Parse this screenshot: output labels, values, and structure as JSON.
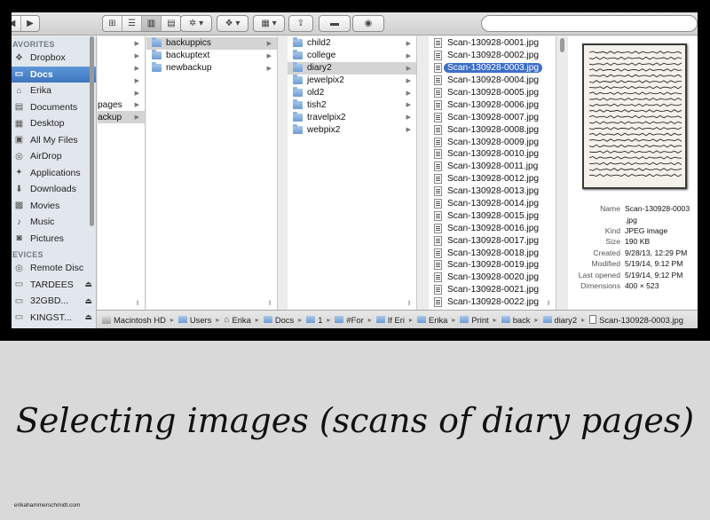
{
  "sidebar": {
    "sections": [
      {
        "title": "AVORITES",
        "items": [
          {
            "label": "Dropbox",
            "icon": "dropbox-icon"
          },
          {
            "label": "Docs",
            "icon": "folder-icon",
            "selected": true
          },
          {
            "label": "Erika",
            "icon": "home-icon"
          },
          {
            "label": "Documents",
            "icon": "documents-icon"
          },
          {
            "label": "Desktop",
            "icon": "desktop-icon"
          },
          {
            "label": "All My Files",
            "icon": "all-files-icon"
          },
          {
            "label": "AirDrop",
            "icon": "airdrop-icon"
          },
          {
            "label": "Applications",
            "icon": "applications-icon"
          },
          {
            "label": "Downloads",
            "icon": "downloads-icon"
          },
          {
            "label": "Movies",
            "icon": "movies-icon"
          },
          {
            "label": "Music",
            "icon": "music-icon"
          },
          {
            "label": "Pictures",
            "icon": "pictures-icon"
          }
        ]
      },
      {
        "title": "EVICES",
        "items": [
          {
            "label": "Remote Disc",
            "icon": "disc-icon"
          },
          {
            "label": "TARDEES",
            "icon": "drive-icon",
            "eject": true
          },
          {
            "label": "32GBD...",
            "icon": "drive-icon",
            "eject": true
          },
          {
            "label": "KINGST...",
            "icon": "drive-icon",
            "eject": true
          }
        ]
      }
    ]
  },
  "columns": {
    "col1": [
      "",
      "",
      "",
      "",
      "",
      "pages",
      "ackup"
    ],
    "col2": [
      "backuppics",
      "backuptext",
      "newbackup"
    ],
    "col3": [
      "child2",
      "college",
      "diary2",
      "jewelpix2",
      "old2",
      "tish2",
      "travelpix2",
      "webpix2"
    ],
    "col4": [
      "Scan-130928-0001.jpg",
      "Scan-130928-0002.jpg",
      "Scan-130928-0003.jpg",
      "Scan-130928-0004.jpg",
      "Scan-130928-0005.jpg",
      "Scan-130928-0006.jpg",
      "Scan-130928-0007.jpg",
      "Scan-130928-0008.jpg",
      "Scan-130928-0009.jpg",
      "Scan-130928-0010.jpg",
      "Scan-130928-0011.jpg",
      "Scan-130928-0012.jpg",
      "Scan-130928-0013.jpg",
      "Scan-130928-0014.jpg",
      "Scan-130928-0015.jpg",
      "Scan-130928-0016.jpg",
      "Scan-130928-0017.jpg",
      "Scan-130928-0018.jpg",
      "Scan-130928-0019.jpg",
      "Scan-130928-0020.jpg",
      "Scan-130928-0021.jpg",
      "Scan-130928-0022.jpg"
    ]
  },
  "preview": {
    "info": [
      {
        "k": "Name",
        "v": "Scan-130928-0003"
      },
      {
        "k": "",
        "v": ".jpg"
      },
      {
        "k": "Kind",
        "v": "JPEG image"
      },
      {
        "k": "Size",
        "v": "190 KB"
      },
      {
        "k": "Created",
        "v": "9/28/13, 12:29 PM"
      },
      {
        "k": "Modified",
        "v": "5/19/14, 9:12 PM"
      },
      {
        "k": "Last opened",
        "v": "5/19/14, 9:12 PM"
      },
      {
        "k": "Dimensions",
        "v": "400 × 523"
      }
    ]
  },
  "pathbar": [
    {
      "label": "Macintosh HD",
      "kind": "hd"
    },
    {
      "label": "Users",
      "kind": "folder"
    },
    {
      "label": "Erika",
      "kind": "home"
    },
    {
      "label": "Docs",
      "kind": "folder"
    },
    {
      "label": "1",
      "kind": "folder"
    },
    {
      "label": "#For",
      "kind": "folder"
    },
    {
      "label": "If Eri",
      "kind": "folder"
    },
    {
      "label": "Erika",
      "kind": "folder"
    },
    {
      "label": "Print",
      "kind": "folder"
    },
    {
      "label": "back",
      "kind": "folder"
    },
    {
      "label": "diary2",
      "kind": "folder"
    },
    {
      "label": "Scan-130928-0003.jpg",
      "kind": "doc"
    }
  ],
  "caption": "Selecting images (scans of diary pages)",
  "credit": "erikahammerschmidt.com",
  "colors": {
    "selection_blue": "#3d6fc6",
    "sidebar_bg": "#e2e7ed"
  }
}
